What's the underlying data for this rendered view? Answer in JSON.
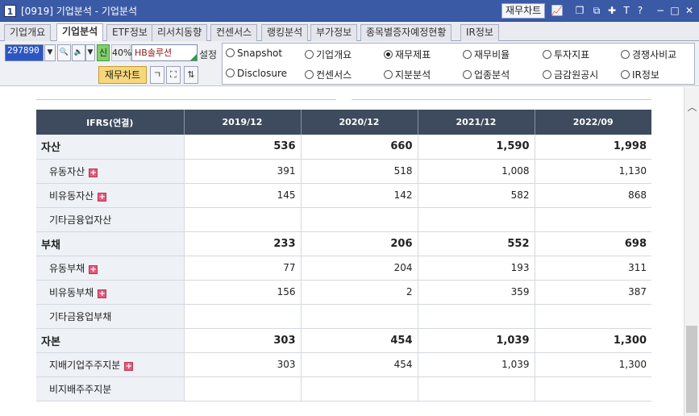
{
  "window": {
    "number": "1",
    "title": "[0919] 기업분석 - 기업분석",
    "chart_button": "재무차트"
  },
  "tabs": [
    "기업개요",
    "기업분석",
    "ETF정보",
    "리서치동향",
    "컨센서스",
    "랭킹분석",
    "부가정보",
    "종목별증자예정현황",
    "IR정보"
  ],
  "toolbar": {
    "code": "297890",
    "sin_label": "신",
    "percent": "40%",
    "company": "HB솔루션",
    "settings_label": "설정",
    "chart_button": "재무차트"
  },
  "radios": [
    {
      "label": "Snapshot",
      "selected": false
    },
    {
      "label": "기업개요",
      "selected": false
    },
    {
      "label": "재무제표",
      "selected": true
    },
    {
      "label": "재무비율",
      "selected": false
    },
    {
      "label": "투자지표",
      "selected": false
    },
    {
      "label": "경쟁사비교",
      "selected": false
    },
    {
      "label": "Disclosure",
      "selected": false
    },
    {
      "label": "컨센서스",
      "selected": false
    },
    {
      "label": "지분분석",
      "selected": false
    },
    {
      "label": "업종분석",
      "selected": false
    },
    {
      "label": "금감원공시",
      "selected": false
    },
    {
      "label": "IR정보",
      "selected": false
    }
  ],
  "table": {
    "header": [
      "IFRS(연결)",
      "2019/12",
      "2020/12",
      "2021/12",
      "2022/09"
    ],
    "rows": [
      {
        "label": "자산",
        "values": [
          "536",
          "660",
          "1,590",
          "1,998"
        ]
      },
      {
        "label": "유동자산",
        "values": [
          "391",
          "518",
          "1,008",
          "1,130"
        ]
      },
      {
        "label": "비유동자산",
        "values": [
          "145",
          "142",
          "582",
          "868"
        ]
      },
      {
        "label": "기타금융업자산",
        "values": [
          "",
          "",
          "",
          ""
        ]
      },
      {
        "label": "부채",
        "values": [
          "233",
          "206",
          "552",
          "698"
        ]
      },
      {
        "label": "유동부채",
        "values": [
          "77",
          "204",
          "193",
          "311"
        ]
      },
      {
        "label": "비유동부채",
        "values": [
          "156",
          "2",
          "359",
          "387"
        ]
      },
      {
        "label": "기타금융업부채",
        "values": [
          "",
          "",
          "",
          ""
        ]
      },
      {
        "label": "자본",
        "values": [
          "303",
          "454",
          "1,039",
          "1,300"
        ]
      },
      {
        "label": "지배기업주주지분",
        "values": [
          "303",
          "454",
          "1,039",
          "1,300"
        ]
      },
      {
        "label": "비지배주주지분",
        "values": [
          "",
          "",
          "",
          ""
        ]
      }
    ]
  }
}
